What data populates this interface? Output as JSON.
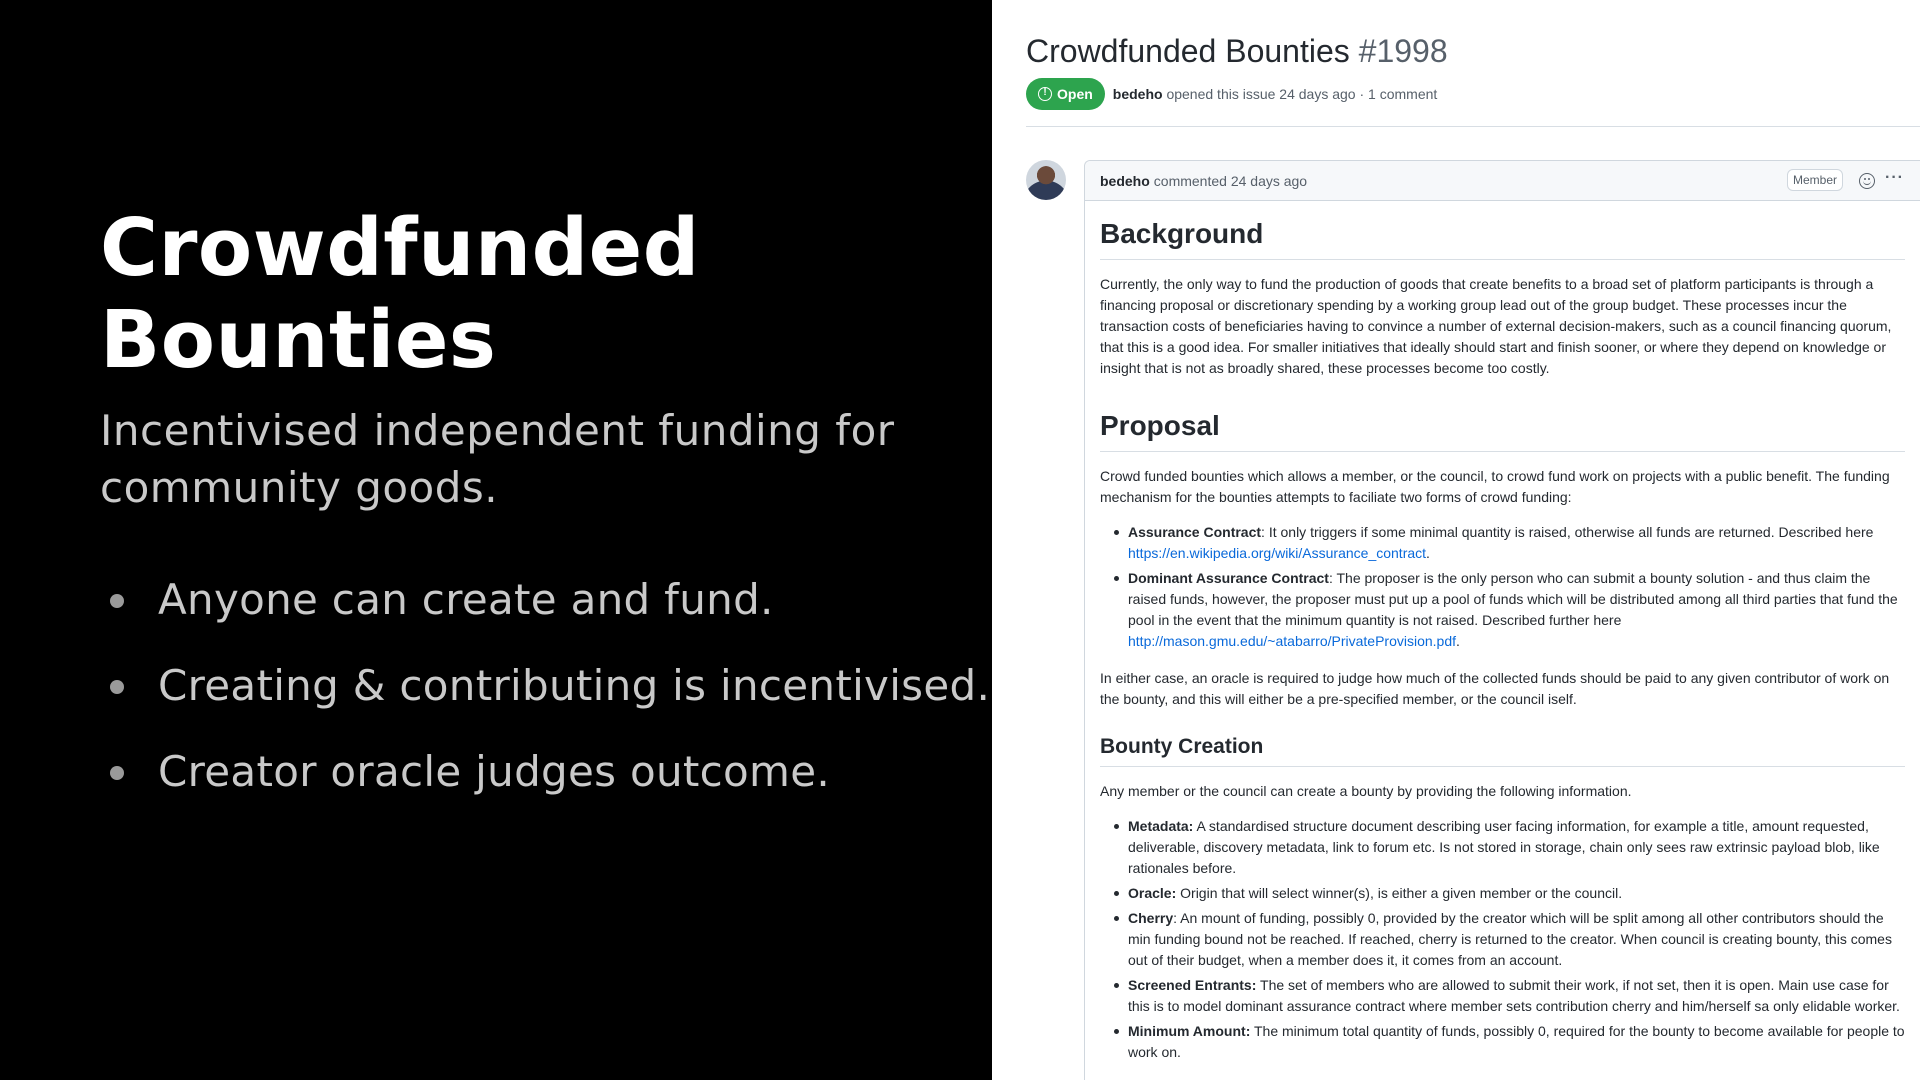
{
  "slide": {
    "title_line1": "Crowdfunded",
    "title_line2": "Bounties",
    "subtitle_line1": "Incentivised independent funding for",
    "subtitle_line2": "community goods.",
    "bullets": [
      "Anyone can create and fund.",
      "Creating & contributing is incentivised.",
      "Creator oracle judges outcome."
    ]
  },
  "issue": {
    "title": "Crowdfunded Bounties",
    "number": "#1998",
    "state": "Open",
    "author": "bedeho",
    "opened_text": "opened this issue 24 days ago · 1 comment",
    "colors": {
      "open_badge": "#2da44e",
      "link": "#0969da"
    }
  },
  "comment": {
    "author": "bedeho",
    "time_text": "commented 24 days ago",
    "badge": "Member",
    "background": {
      "heading": "Background",
      "text": "Currently, the only way to fund the production of goods that create benefits to a broad set of platform participants is through a financing proposal or discretionary spending by a working group lead out of the group budget. These processes incur the transaction costs of beneficiaries having to convince a number of external decision-makers, such as a council financing quorum, that this is a good idea. For smaller initiatives that ideally should start and finish sooner, or where they depend on knowledge or insight that is not as broadly shared, these processes become too costly."
    },
    "proposal": {
      "heading": "Proposal",
      "intro": "Crowd funded bounties which allows a member, or the council, to crowd fund work on projects with a public benefit. The funding mechanism for the bounties attempts to faciliate two forms of crowd funding:",
      "items": [
        {
          "term": "Assurance Contract",
          "text": ": It only triggers if some minimal quantity is raised, otherwise all funds are returned. Described here ",
          "link": "https://en.wikipedia.org/wiki/Assurance_contract",
          "after": "."
        },
        {
          "term": "Dominant Assurance Contract",
          "text": ": The proposer is the only person who can submit a bounty solution - and thus claim the raised funds, however, the proposer must put up a pool of funds which will be distributed among all third parties that fund the pool in the event that the minimum quantity is not raised. Described further here ",
          "link": "http://mason.gmu.edu/~atabarro/PrivateProvision.pdf",
          "after": "."
        }
      ],
      "closing": "In either case, an oracle is required to judge how much of the collected funds should be paid to any given contributor of work on the bounty, and this will either be a pre-specified member, or the council iself."
    },
    "bounty_creation": {
      "heading": "Bounty Creation",
      "intro": "Any member or the council can create a bounty by providing the following information.",
      "items": [
        {
          "term": "Metadata:",
          "text": " A standardised structure document describing user facing information, for example a title, amount requested, deliverable, discovery metadata, link to forum etc. Is not stored in storage, chain only sees raw extrinsic payload blob, like rationales before."
        },
        {
          "term": "Oracle:",
          "text": " Origin that will select winner(s), is either a given member or the council."
        },
        {
          "term": "Cherry",
          "text": ": An mount of funding, possibly 0, provided by the creator which will be split among all other contributors should the min funding bound not be reached. If reached, cherry is returned to the creator. When council is creating bounty, this comes out of their budget, when a member does it, it comes from an account."
        },
        {
          "term": "Screened Entrants:",
          "text": " The set of members who are allowed to submit their work, if not set, then it is open. Main use case for this is to model dominant assurance contract where member sets contribution cherry and him/herself sa only elidable worker."
        },
        {
          "term": "Minimum Amount:",
          "text": " The minimum total quantity of funds, possibly 0, required for the bounty to become available for people to work on."
        }
      ]
    }
  }
}
